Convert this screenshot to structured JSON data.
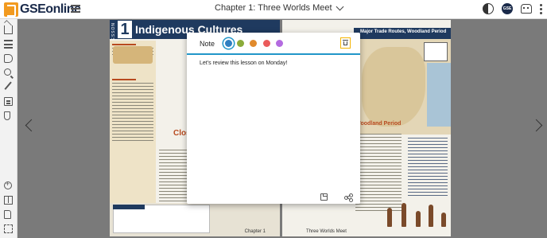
{
  "app": {
    "brand": "GSEonline"
  },
  "header": {
    "title": "Chapter 1: Three Worlds Meet"
  },
  "top_icons": {
    "avatar_text": "GSE"
  },
  "left_page": {
    "lesson_label": "LESSON",
    "lesson_number": "1",
    "lesson_title": "Indigenous Cultures",
    "section_head": "Close",
    "footer_label": "Chapter 1"
  },
  "right_page": {
    "map_title": "Major Trade Routes, Woodland Period",
    "section_title": "Woodland Period",
    "footer_label": "Three Worlds Meet"
  },
  "note_modal": {
    "label": "Note",
    "colors": [
      {
        "name": "blue",
        "hex": "#2f7fc1",
        "selected": true
      },
      {
        "name": "green",
        "hex": "#8bab3a",
        "selected": false
      },
      {
        "name": "orange",
        "hex": "#e08a2c",
        "selected": false
      },
      {
        "name": "red",
        "hex": "#ea5b5b",
        "selected": false
      },
      {
        "name": "purple",
        "hex": "#b46be0",
        "selected": false
      }
    ],
    "text": "Let's review this lesson on Monday!"
  },
  "theme": {
    "accent": "#2196c9",
    "highlight": "#f5b400",
    "brand_orange": "#f29a1f"
  }
}
